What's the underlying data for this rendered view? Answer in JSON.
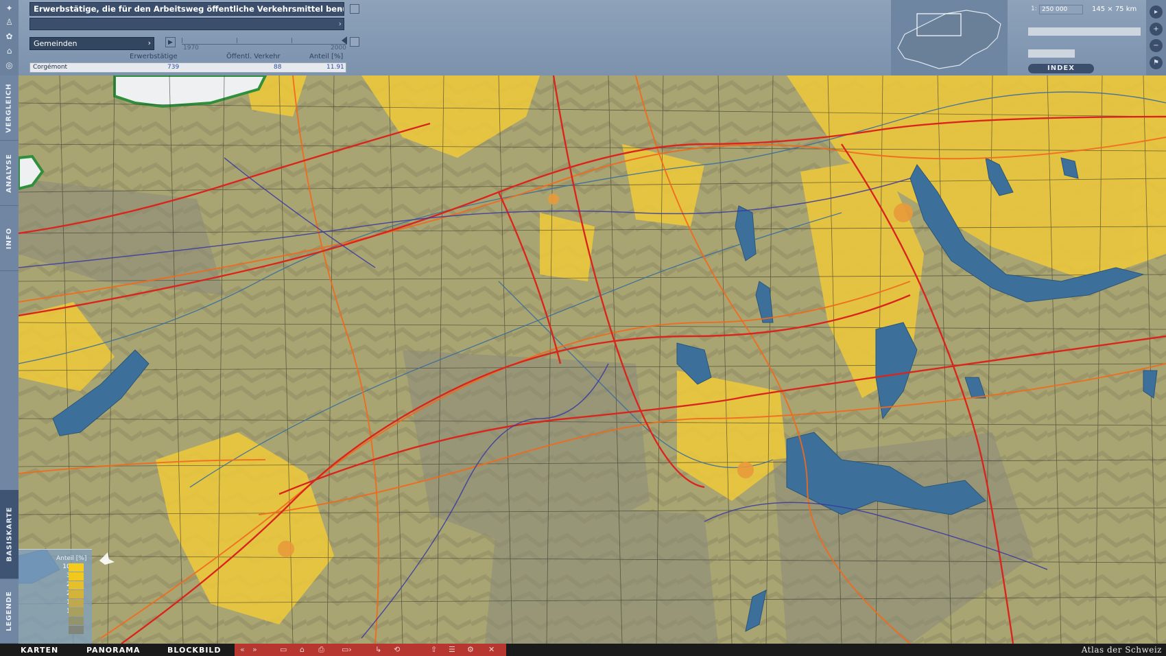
{
  "header": {
    "title": "Erwerbstätige, die für den Arbeitsweg öffentliche Verkehrsmittel benutzen",
    "subtitle": "",
    "level_select": "Gemeinden",
    "year_start": "1970",
    "year_end": "2000"
  },
  "table": {
    "columns": [
      "Erwerbstätige",
      "Öffentl. Verkehr",
      "Anteil [%]"
    ],
    "row": {
      "name": "Corgémont",
      "workers": "739",
      "public": "88",
      "share": "11.91"
    }
  },
  "scale": {
    "prefix": "1:",
    "value": "250 000",
    "extent": "145 × 75 km"
  },
  "index_label": "INDEX",
  "vtabs": [
    "VERGLEICH",
    "ANALYSE",
    "INFO",
    "BASISKARTE",
    "LEGENDE"
  ],
  "legend": {
    "title": "Anteil [%]",
    "labels": [
      "100.0",
      "30.0",
      "25.0",
      "20.0",
      "15.0",
      "10.0",
      "5.0",
      "0.0"
    ],
    "colors": [
      "#f5cc1c",
      "#f0c81e",
      "#e6c02a",
      "#d3b33a",
      "#bfa84e",
      "#a9a060",
      "#93936e",
      "#80867a"
    ]
  },
  "bottom": {
    "tabs": [
      "KARTEN",
      "PANORAMA",
      "BLOCKBILD"
    ],
    "brand": "Atlas der Schweiz"
  },
  "colors": {
    "panel": "#7f93ab",
    "dark_panel": "#3b4e6c",
    "water": "#3c6f9a",
    "rail": "#d9251c",
    "road": "#f06a1d",
    "tram": "#3a3aa0"
  }
}
